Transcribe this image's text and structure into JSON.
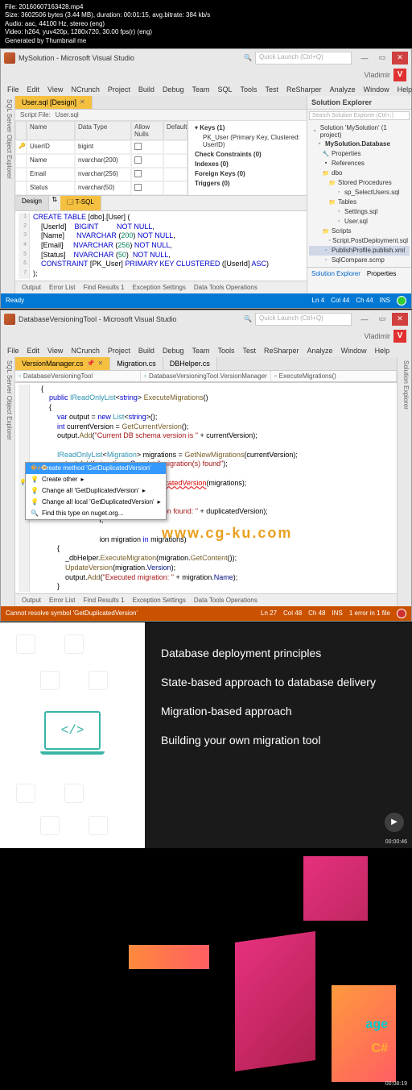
{
  "video_meta": {
    "file": "File: 20160607163428.mp4",
    "size": "Size: 3602506 bytes (3.44 MB), duration: 00:01:15, avg.bitrate: 384 kb/s",
    "audio": "Audio: aac, 44100 Hz, stereo (eng)",
    "video": "Video: h264, yuv420p, 1280x720, 30.00 fps(r) (eng)",
    "gen": "Generated by Thumbnail me"
  },
  "vs1": {
    "title": "MySolution - Microsoft Visual Studio",
    "quick_launch": "Quick Launch (Ctrl+Q)",
    "user": "Vladimir",
    "user_initial": "V",
    "menu": [
      "File",
      "Edit",
      "View",
      "NCrunch",
      "Project",
      "Build",
      "Debug",
      "Team",
      "SQL",
      "Tools",
      "Test",
      "ReSharper",
      "Analyze",
      "Window",
      "Help"
    ],
    "side_tab": "SQL Server Object Explorer",
    "doc_tab": "User.sql [Design]",
    "script_label": "Script File:",
    "script_value": "User.sql",
    "grid_headers": [
      "Name",
      "Data Type",
      "Allow Nulls",
      "Default"
    ],
    "grid_rows": [
      {
        "key": true,
        "name": "UserID",
        "type": "bigint"
      },
      {
        "key": false,
        "name": "Name",
        "type": "nvarchar(200)"
      },
      {
        "key": false,
        "name": "Email",
        "type": "nvarchar(256)"
      },
      {
        "key": false,
        "name": "Status",
        "type": "nvarchar(50)"
      }
    ],
    "right_panel": {
      "keys_title": "Keys (1)",
      "keys_item": "PK_User (Primary Key, Clustered: UserID)",
      "check": "Check Constraints (0)",
      "indexes": "Indexes (0)",
      "fk": "Foreign Keys (0)",
      "triggers": "Triggers (0)"
    },
    "design_tabs": [
      "Design",
      "T-SQL"
    ],
    "sql_code": [
      "CREATE TABLE [dbo].[User]",
      "    [UserId]    BIGINT         NOT NULL,",
      "    [Name]      NVARCHAR (200) NOT NULL,",
      "    [Email]     NVARCHAR (256) NOT NULL,",
      "    [Status]    NVARCHAR (50)  NOT NULL,",
      "    CONSTRAINT [PK_User] PRIMARY KEY CLUSTERED ([UserId] ASC)",
      ");"
    ],
    "bottom_tabs": [
      "Output",
      "Error List",
      "Find Results 1",
      "Exception Settings",
      "Data Tools Operations"
    ],
    "status": {
      "ready": "Ready",
      "ln": "Ln 4",
      "col": "Col 44",
      "ch": "Ch 44",
      "ins": "INS"
    },
    "solution": {
      "title": "Solution Explorer",
      "search": "Search Solution Explorer (Ctrl+;)",
      "root": "Solution 'MySolution' (1 project)",
      "proj": "MySolution.Database",
      "props": "Properties",
      "refs": "References",
      "dbo": "dbo",
      "sp": "Stored Procedures",
      "sp1": "sp_SelectUsers.sql",
      "tables": "Tables",
      "t1": "Settings.sql",
      "t2": "User.sql",
      "scripts": "Scripts",
      "s1": "Script.PostDeployment.sql",
      "s2": "PublishProfile.publish.xml",
      "s3": "SqlCompare.scmp",
      "tabs": [
        "Solution Explorer",
        "Properties"
      ]
    }
  },
  "vs2": {
    "title": "DatabaseVersioningTool - Microsoft Visual Studio",
    "quick_launch": "Quick Launch (Ctrl+Q)",
    "user": "Vladimir",
    "user_initial": "V",
    "menu": [
      "File",
      "Edit",
      "View",
      "NCrunch",
      "Project",
      "Build",
      "Debug",
      "Team",
      "Tools",
      "Test",
      "ReSharper",
      "Analyze",
      "Window",
      "Help"
    ],
    "tabs": [
      {
        "name": "VersionManager.cs",
        "active": true
      },
      {
        "name": "Migration.cs"
      },
      {
        "name": "DBHelper.cs"
      }
    ],
    "nav": [
      "DatabaseVersioningTool",
      "DatabaseVersioningTool.VersionManager",
      "ExecuteMigrations()"
    ],
    "intellisense": [
      "Create method 'GetDuplicatedVersion'",
      "Create other",
      "Change all 'GetDuplicatedVersion'",
      "Change all local 'GetDuplicatedVersion'",
      "Find this type on nuget.org..."
    ],
    "bottom_tabs": [
      "Output",
      "Error List",
      "Find Results 1",
      "Exception Settings",
      "Data Tools Operations"
    ],
    "status": {
      "error": "Cannot resolve symbol 'GetDuplicatedVersion'",
      "ln": "Ln 27",
      "col": "Col 48",
      "ch": "Ch 48",
      "ins": "INS",
      "errors": "1 error in 1 file"
    },
    "side_left": "SQL Server Object Explorer",
    "side_right": "Solution Explorer"
  },
  "slide1": {
    "lines": [
      "Database deployment principles",
      "State-based approach to database delivery",
      "Migration-based approach",
      "Building your own migration tool"
    ],
    "timecode": "00:00:46",
    "laptop_code": "</>"
  },
  "slide2": {
    "text1": "age",
    "text2": "C#",
    "timecode": "00:08:19"
  },
  "watermark": "www.cg-ku.com"
}
